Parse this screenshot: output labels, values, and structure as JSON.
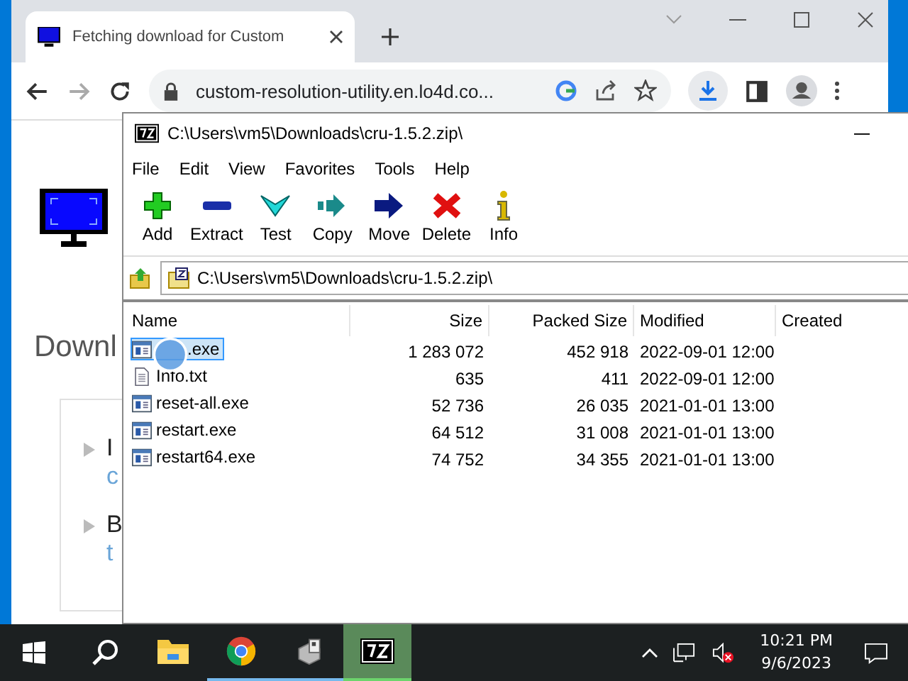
{
  "browser": {
    "tab_title": "Fetching download for Custom",
    "url": "custom-resolution-utility.en.lo4d.co...",
    "page": {
      "heading": "Downl",
      "items": [
        {
          "title": "I",
          "link": "c"
        },
        {
          "title": "B",
          "link": "t"
        }
      ]
    }
  },
  "archiver": {
    "title": "C:\\Users\\vm5\\Downloads\\cru-1.5.2.zip\\",
    "menu": [
      "File",
      "Edit",
      "View",
      "Favorites",
      "Tools",
      "Help"
    ],
    "toolbar": [
      {
        "label": "Add",
        "kind": "add"
      },
      {
        "label": "Extract",
        "kind": "extract"
      },
      {
        "label": "Test",
        "kind": "test"
      },
      {
        "label": "Copy",
        "kind": "copy"
      },
      {
        "label": "Move",
        "kind": "move"
      },
      {
        "label": "Delete",
        "kind": "delete"
      },
      {
        "label": "Info",
        "kind": "info"
      }
    ],
    "path": "C:\\Users\\vm5\\Downloads\\cru-1.5.2.zip\\",
    "columns": [
      "Name",
      "Size",
      "Packed Size",
      "Modified",
      "Created"
    ],
    "rows": [
      {
        "name": ".exe",
        "kind": "exe",
        "size": "1 283 072",
        "packed": "452 918",
        "modified": "2022-09-01 12:00",
        "selected": true
      },
      {
        "name": "Info.txt",
        "kind": "txt",
        "size": "635",
        "packed": "411",
        "modified": "2022-09-01 12:00",
        "selected": false
      },
      {
        "name": "reset-all.exe",
        "kind": "exe",
        "size": "52 736",
        "packed": "26 035",
        "modified": "2021-01-01 13:00",
        "selected": false
      },
      {
        "name": "restart.exe",
        "kind": "exe",
        "size": "64 512",
        "packed": "31 008",
        "modified": "2021-01-01 13:00",
        "selected": false
      },
      {
        "name": "restart64.exe",
        "kind": "exe",
        "size": "74 752",
        "packed": "34 355",
        "modified": "2021-01-01 13:00",
        "selected": false
      }
    ]
  },
  "taskbar": {
    "apps": [
      {
        "kind": "folder",
        "running": false,
        "selected": false
      },
      {
        "kind": "browser",
        "running": true,
        "selected": false
      },
      {
        "kind": "network",
        "running": true,
        "selected": false
      },
      {
        "kind": "archiver",
        "running": true,
        "selected": true
      }
    ],
    "time": "10:21 PM",
    "date": "9/6/2023"
  }
}
